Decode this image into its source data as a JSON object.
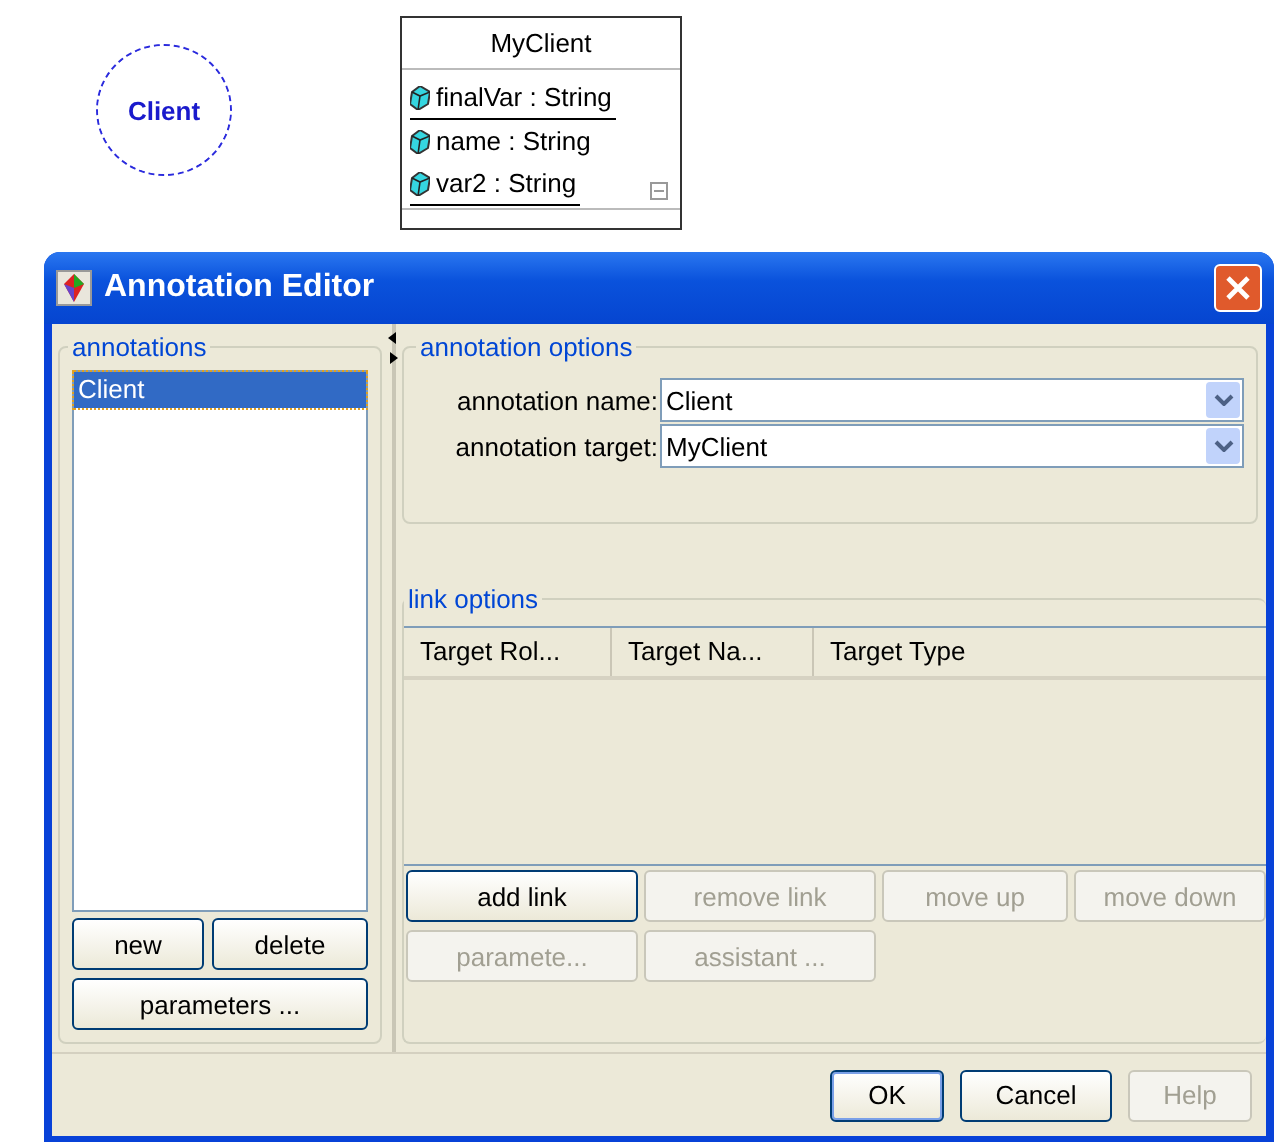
{
  "diagram": {
    "annotation": {
      "label": "Client"
    },
    "class": {
      "name": "MyClient",
      "attributes": [
        {
          "text": "finalVar : String",
          "underlined": true
        },
        {
          "text": "name : String",
          "underlined": false
        },
        {
          "text": "var2 : String",
          "underlined": true
        }
      ]
    }
  },
  "window": {
    "title": "Annotation Editor"
  },
  "annotations": {
    "title": "annotations",
    "items": [
      {
        "label": "Client",
        "selected": true
      }
    ],
    "buttons": [
      {
        "label": "new",
        "disabled": false
      },
      {
        "label": "delete",
        "disabled": false
      },
      {
        "label": "parameters ...",
        "disabled": false
      }
    ]
  },
  "annotation_options": {
    "title": "annotation options",
    "fields": [
      {
        "label": "annotation name:",
        "value": "Client"
      },
      {
        "label": "annotation target:",
        "value": "MyClient"
      }
    ]
  },
  "link_options": {
    "title": "link options",
    "columns": [
      "Target Rol...",
      "Target Na...",
      "Target Type"
    ],
    "buttons": [
      {
        "label": "add link",
        "disabled": false
      },
      {
        "label": "remove link",
        "disabled": true
      },
      {
        "label": "move up",
        "disabled": true
      },
      {
        "label": "move down",
        "disabled": true
      },
      {
        "label": "paramete...",
        "disabled": true
      },
      {
        "label": "assistant ...",
        "disabled": true
      }
    ]
  },
  "footer_buttons": [
    {
      "label": "OK",
      "disabled": false,
      "default": true
    },
    {
      "label": "Cancel",
      "disabled": false,
      "default": false
    },
    {
      "label": "Help",
      "disabled": true,
      "default": false
    }
  ]
}
